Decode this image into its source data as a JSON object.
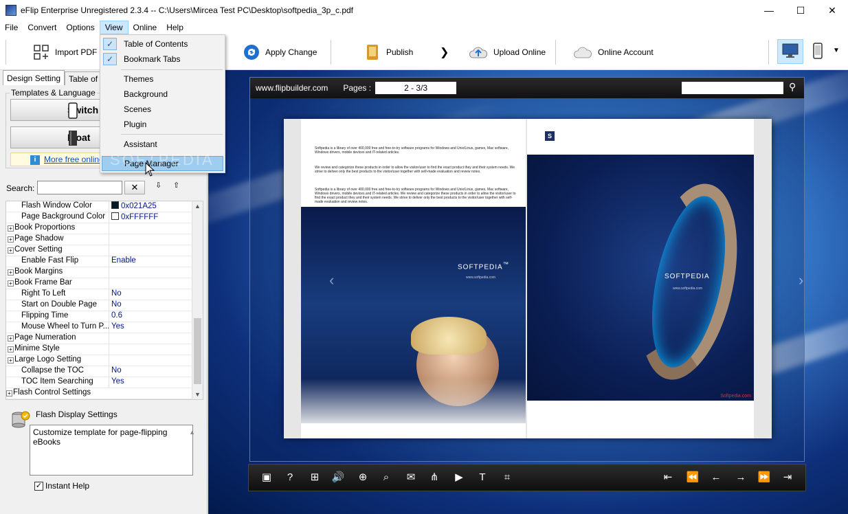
{
  "window": {
    "title": "eFlip Enterprise Unregistered 2.3.4   -- C:\\Users\\Mircea Test PC\\Desktop\\softpedia_3p_c.pdf",
    "minimize": "—",
    "maximize": "☐",
    "close": "✕"
  },
  "menu": [
    "File",
    "Convert",
    "Options",
    "View",
    "Online",
    "Help"
  ],
  "toolbar": {
    "import_pdf": "Import PDF",
    "apply_change": "Apply Change",
    "publish": "Publish",
    "upload_online": "Upload Online",
    "online_account": "Online Account",
    "more": "▼",
    "arrow": "❯"
  },
  "view_menu": {
    "items": [
      {
        "label": "Table of Contents",
        "checked": true
      },
      {
        "label": "Bookmark Tabs",
        "checked": true
      },
      {
        "label": "Themes"
      },
      {
        "label": "Background"
      },
      {
        "label": "Scenes"
      },
      {
        "label": "Plugin"
      },
      {
        "label": "Assistant"
      },
      {
        "label": "Page Manager",
        "highlighted": true
      }
    ],
    "check": "✓"
  },
  "left_panel": {
    "tabs": [
      "Design Setting",
      "Table of Co"
    ],
    "group_label": "Templates & Language",
    "switch_button": "Switch t",
    "float_button": "Float",
    "more_link": "More free online",
    "info_glyph": "i",
    "search_label": "Search:",
    "search_value": "",
    "clear_glyph": "✕",
    "sort_up": "⇩",
    "sort_down": "⇧",
    "expand_glyph": "+",
    "scroll_up": "▲",
    "scroll_down": "▼"
  },
  "properties": [
    {
      "name": "Flash Window Color",
      "value": "0x021A25",
      "swatch": "#021A25"
    },
    {
      "name": "Page Background Color",
      "value": "0xFFFFFF",
      "swatch": "#FFFFFF"
    },
    {
      "name": "Book Proportions",
      "group": true
    },
    {
      "name": "Page Shadow",
      "group": true
    },
    {
      "name": "Cover Setting",
      "group": true
    },
    {
      "name": "Enable Fast Flip",
      "value": "Enable"
    },
    {
      "name": "Book Margins",
      "group": true
    },
    {
      "name": "Book Frame Bar",
      "group": true
    },
    {
      "name": "Right To Left",
      "value": "No"
    },
    {
      "name": "Start on Double Page",
      "value": "No"
    },
    {
      "name": "Flipping Time",
      "value": "0.6"
    },
    {
      "name": "Mouse Wheel to Turn P...",
      "value": "Yes"
    },
    {
      "name": "Page Numeration",
      "group": true
    },
    {
      "name": "Minime Style",
      "group": true
    },
    {
      "name": "Large Logo Setting",
      "group": true
    },
    {
      "name": "Collapse the TOC",
      "value": "No"
    },
    {
      "name": "TOC Item Searching",
      "value": "Yes"
    },
    {
      "name": "Flash Control Settings",
      "group": true,
      "top": true
    }
  ],
  "help": {
    "title": "Flash Display Settings",
    "text": "Customize template for page-flipping eBooks",
    "instant_help": "Instant Help",
    "check": "✓"
  },
  "viewer": {
    "site": "www.flipbuilder.com",
    "pages_label": "Pages :",
    "pages_value": "2 - 3/3",
    "search_glyph": "⚲",
    "nav_prev": "‹",
    "nav_next": "›",
    "page_text": [
      "Softpedia is a library of over 400,000 free and free-to-try software programs for Windows and Unix/Linux, games, Mac software, Windows drivers, mobile devices and IT-related articles.",
      "We review and categorize these products in order to allow the visitor/user to find the exact product they and their system needs. We strive to deliver only the best products to the visitor/user together with self-made evaluation and review notes.",
      "Softpedia is a library of over 400,000 free and free-to-try software programs for Windows and Unix/Linux, games, Mac software, Windows drivers, mobile devices and IT-related articles. We review and categorize these products in order to allow the visitor/user to find the exact product they and their system needs. We strive to deliver only the best products to the visitor/user together with self-made evaluation and review notes."
    ],
    "logo": "SOFTPEDIA",
    "logo_tm": "™",
    "logo_sub": "www.softpedia.com",
    "badge": "S",
    "red_text": "Softpedia.com",
    "controls": [
      "▣",
      "?",
      "⊞",
      "🔊",
      "⊕",
      "⌕",
      "✉",
      "⋔",
      "▶",
      "T",
      "⌗",
      "⇤",
      "⏪",
      "←",
      "→",
      "⏩",
      "⇥"
    ]
  },
  "watermark": "SOFTPEDIA"
}
